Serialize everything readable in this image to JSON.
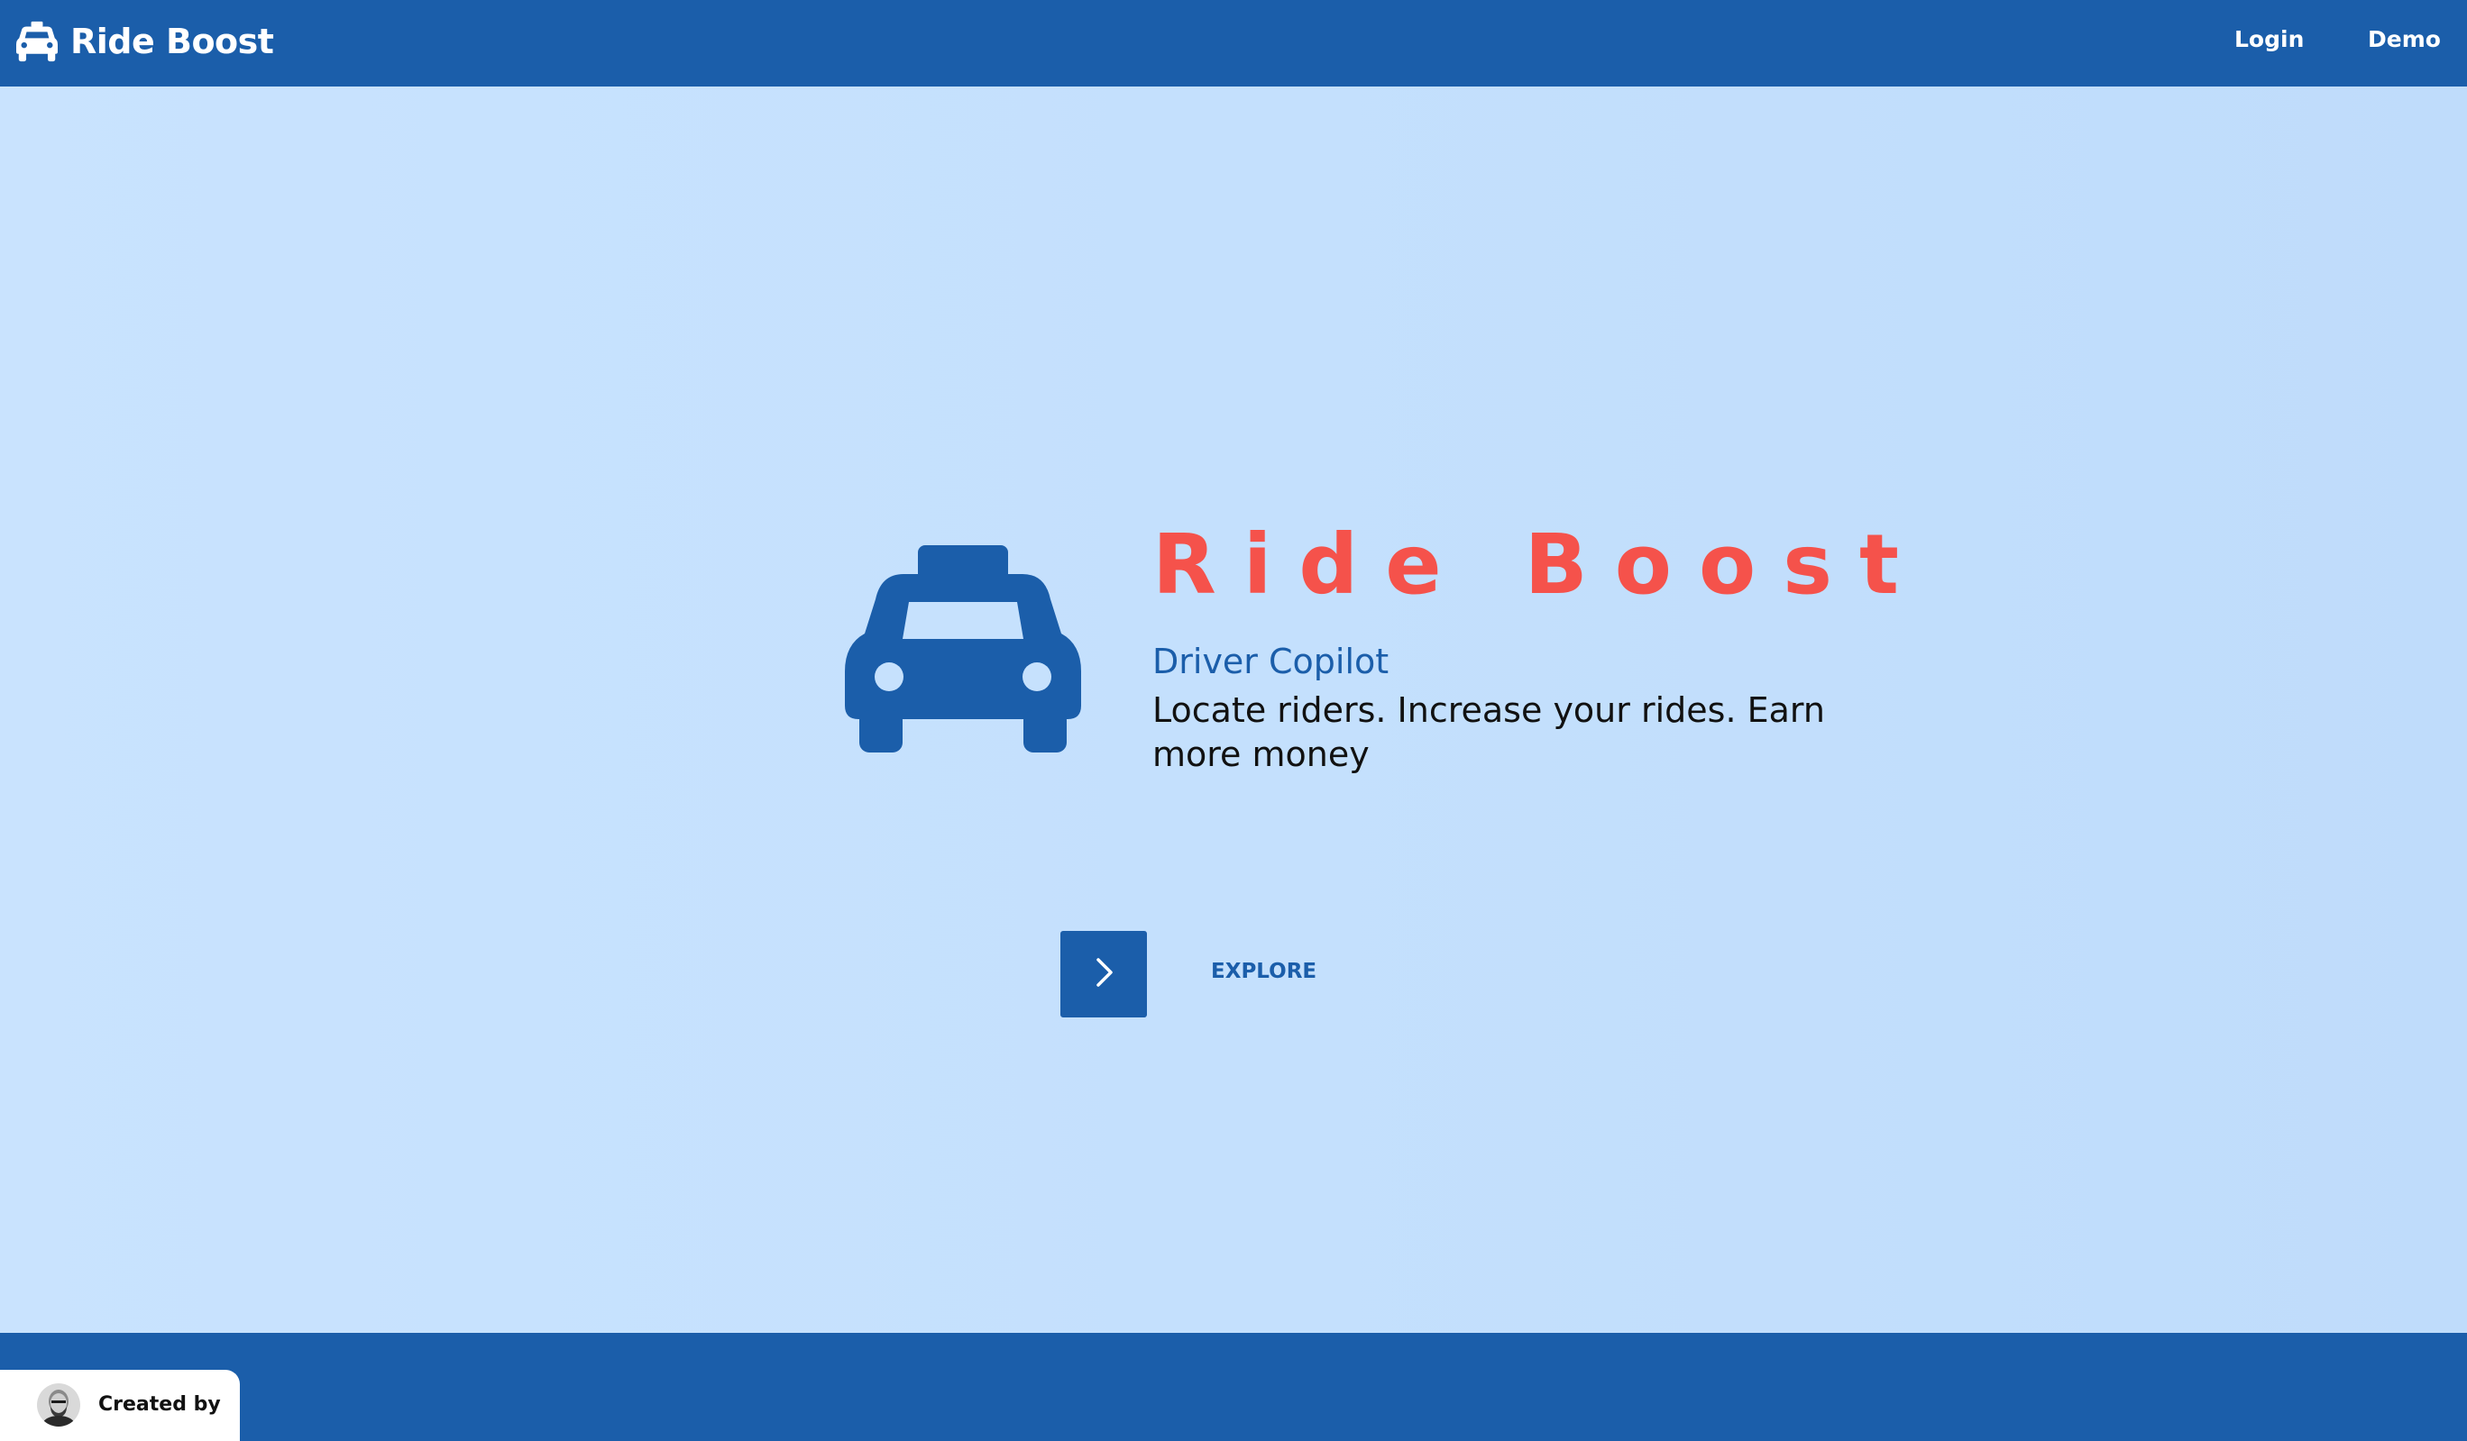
{
  "navbar": {
    "brand_icon": "taxi-icon",
    "brand_name": "Ride Boost",
    "links": [
      {
        "label": "Login"
      },
      {
        "label": "Demo"
      }
    ]
  },
  "hero": {
    "icon": "taxi-icon",
    "title": "Ride Boost",
    "subtitle": "Driver Copilot",
    "tagline": "Locate riders. Increase your rides. Earn more money",
    "explore_icon": "chevron-right-icon",
    "explore_label": "EXPLORE"
  },
  "footer": {
    "avatar": "creator-avatar",
    "created_by_label": "Created by"
  },
  "colors": {
    "primary": "#1b5eaa",
    "accent": "#f5524b",
    "background": "#c6e1fd",
    "text": "#111111",
    "white": "#ffffff"
  }
}
